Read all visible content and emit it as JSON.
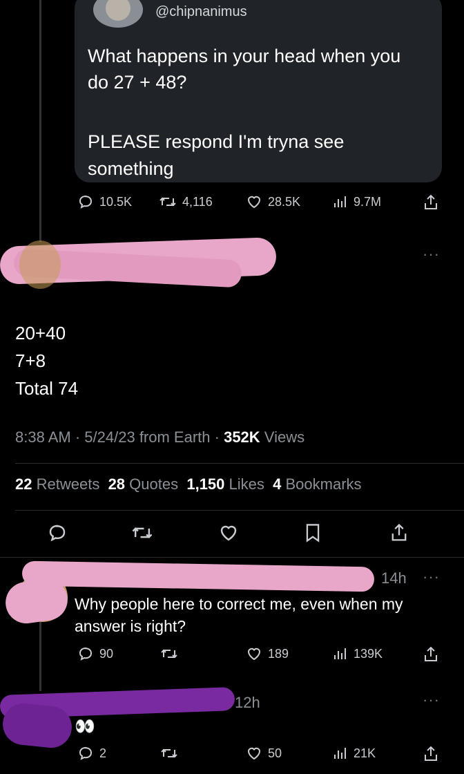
{
  "quoted_tweet": {
    "handle": "@chipnanimus",
    "text_line1": "What happens in your head when you",
    "text_line2": "do 27 + 48?",
    "text_line3": "PLEASE respond I'm tryna see",
    "text_line4": "something",
    "replies": "10.5K",
    "retweets": "4,116",
    "likes": "28.5K",
    "views": "9.7M"
  },
  "main_tweet": {
    "line1": "20+40",
    "line2": "7+8",
    "line3": "Total 74",
    "time": "8:38 AM",
    "date": "5/24/23",
    "source": "from Earth",
    "views_count": "352K",
    "views_label": "Views",
    "retweets_count": "22",
    "retweets_label": "Retweets",
    "quotes_count": "28",
    "quotes_label": "Quotes",
    "likes_count": "1,150",
    "likes_label": "Likes",
    "bookmarks_count": "4",
    "bookmarks_label": "Bookmarks"
  },
  "reply1": {
    "time": "14h",
    "text_line1": "Why people here to correct me, even when my",
    "text_line2": "answer is right?",
    "replies": "90",
    "likes": "189",
    "views": "139K"
  },
  "reply2": {
    "time": "12h",
    "emoji": "👀",
    "replies": "2",
    "likes": "50",
    "views": "21K"
  },
  "more_glyph": "···",
  "colors": {
    "background": "#000000",
    "card": "#202327",
    "muted": "#8b9096",
    "redaction_pink": "#e8a6c8",
    "redaction_purple": "#7a2aa0"
  }
}
